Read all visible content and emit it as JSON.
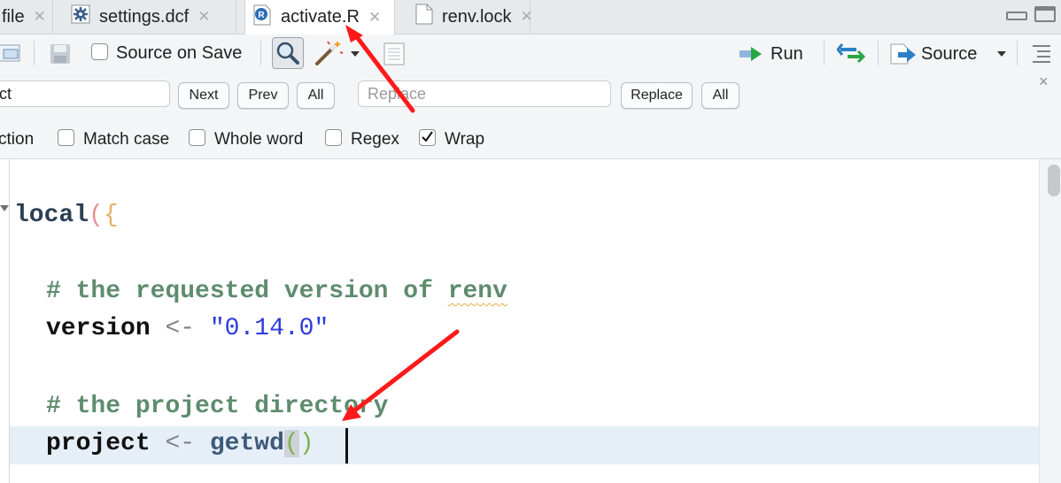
{
  "tabs": [
    {
      "label": "file",
      "active": false,
      "icon": "none"
    },
    {
      "label": "settings.dcf",
      "active": false,
      "icon": "gear-icon"
    },
    {
      "label": "activate.R",
      "active": true,
      "icon": "r-file-icon"
    },
    {
      "label": "renv.lock",
      "active": false,
      "icon": "document-icon"
    }
  ],
  "toolbar": {
    "source_on_save": "Source on Save",
    "run": "Run",
    "source": "Source"
  },
  "find": {
    "find_value": "ct",
    "replace_placeholder": "Replace",
    "next": "Next",
    "prev": "Prev",
    "all": "All",
    "replace": "Replace",
    "replace_all": "All",
    "in_selection": "ction",
    "match_case": "Match case",
    "whole_word": "Whole word",
    "regex": "Regex",
    "wrap": "Wrap",
    "wrap_checked": true,
    "close": "×"
  },
  "code": {
    "line1_kw": "local",
    "line1_p1": "(",
    "line1_p2": "{",
    "comment1_hash": "#",
    "comment1_text": "the requested version of",
    "comment1_word": "renv",
    "var_version": "version",
    "assign_op": "<-",
    "version_string": "\"0.14.0\"",
    "comment2_hash": "#",
    "comment2_text": "the project directory",
    "var_project": "project",
    "assign_op2": "<-",
    "getwd": "getwd",
    "paren_open": "(",
    "paren_close": ")"
  },
  "annotations": {
    "arrow_color": "#ff1a1a"
  }
}
